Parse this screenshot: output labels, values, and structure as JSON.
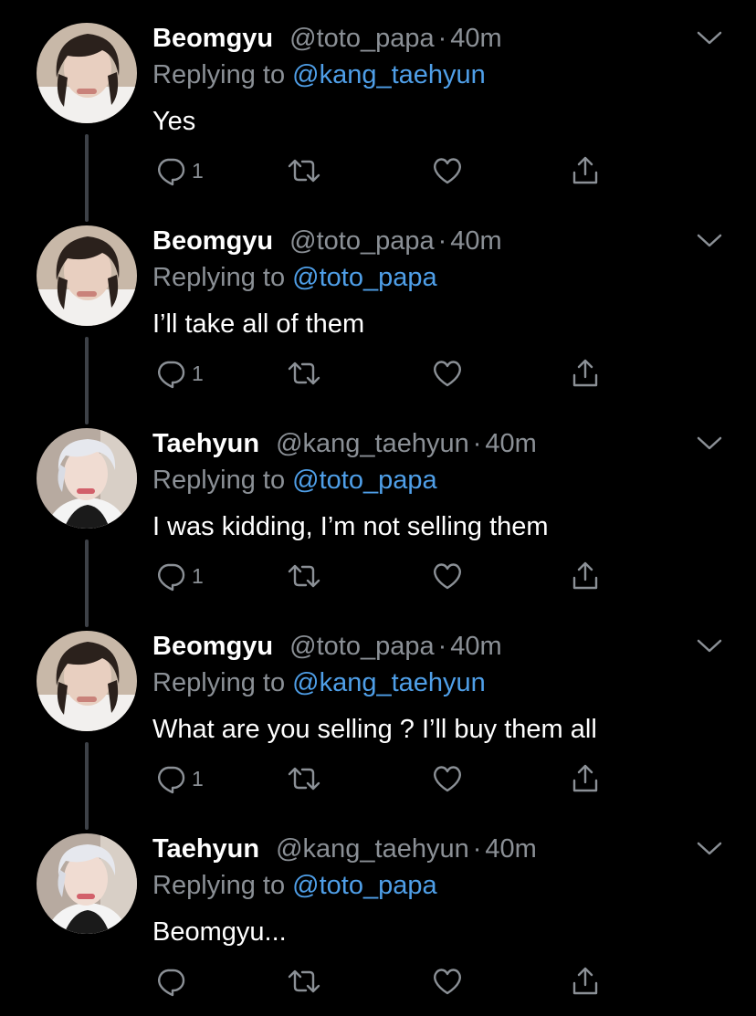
{
  "tweets": [
    {
      "name": "Beomgyu",
      "handle": "@toto_papa",
      "separator": "·",
      "time": "40m",
      "replying_prefix": "Replying to",
      "replying_to": "@kang_taehyun",
      "text": "Yes",
      "reply_count": "1",
      "avatar": "beomgyu-avatar",
      "has_thread_line": true
    },
    {
      "name": "Beomgyu",
      "handle": "@toto_papa",
      "separator": "·",
      "time": "40m",
      "replying_prefix": "Replying to",
      "replying_to": "@toto_papa",
      "text": "I’ll take all of them",
      "reply_count": "1",
      "avatar": "beomgyu-avatar",
      "has_thread_line": true
    },
    {
      "name": "Taehyun",
      "handle": "@kang_taehyun",
      "separator": "·",
      "time": "40m",
      "replying_prefix": "Replying to",
      "replying_to": "@toto_papa",
      "text": "I was kidding, I’m not selling them",
      "reply_count": "1",
      "avatar": "taehyun-avatar",
      "has_thread_line": true
    },
    {
      "name": "Beomgyu",
      "handle": "@toto_papa",
      "separator": "·",
      "time": "40m",
      "replying_prefix": "Replying to",
      "replying_to": "@kang_taehyun",
      "text": "What are you selling ? I’ll buy them all",
      "reply_count": "1",
      "avatar": "beomgyu-avatar",
      "has_thread_line": true
    },
    {
      "name": "Taehyun",
      "handle": "@kang_taehyun",
      "separator": "·",
      "time": "40m",
      "replying_prefix": "Replying to",
      "replying_to": "@toto_papa",
      "text": "Beomgyu...",
      "reply_count": "",
      "avatar": "taehyun-avatar",
      "has_thread_line": false
    }
  ],
  "icons": {
    "reply": "reply-icon",
    "retweet": "retweet-icon",
    "like": "heart-icon",
    "share": "share-icon",
    "more": "chevron-down-icon"
  },
  "colors": {
    "background": "#000000",
    "text": "#ffffff",
    "secondary": "#8b9096",
    "link": "#4f9fe8",
    "thread_line": "#3d4147"
  }
}
